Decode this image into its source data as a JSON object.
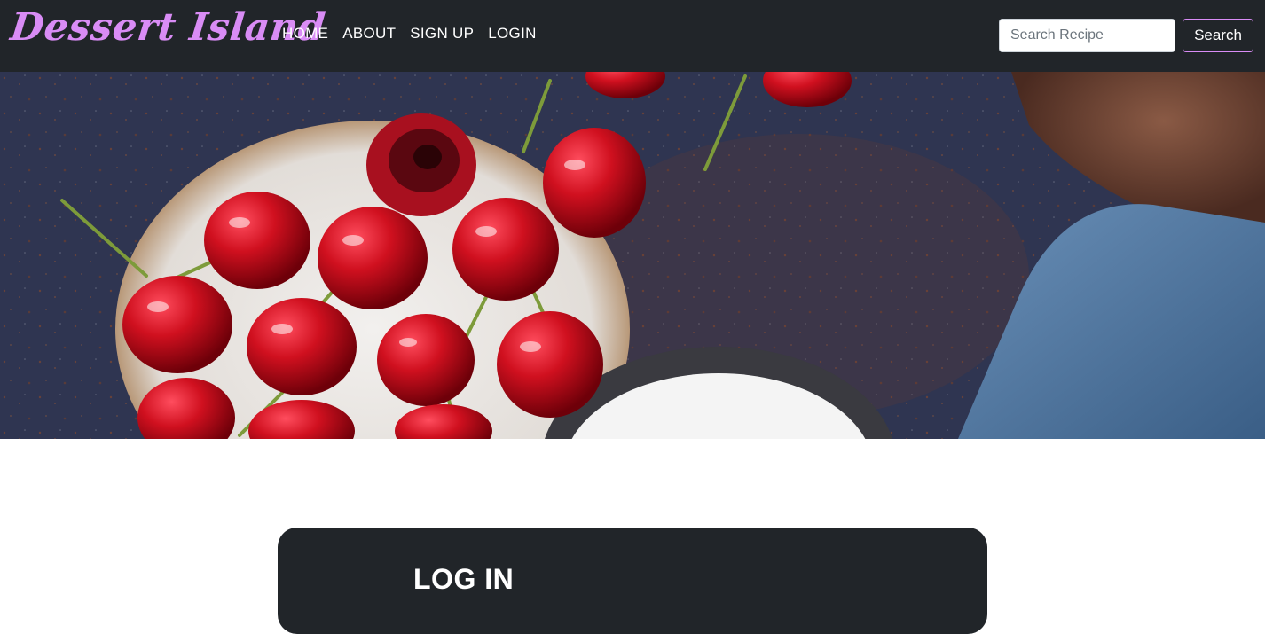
{
  "navbar": {
    "brand": "Dessert Island",
    "links": [
      "HOME",
      "ABOUT",
      "SIGN UP",
      "LOGIN"
    ],
    "search": {
      "placeholder": "Search Recipe",
      "value": "",
      "button_label": "Search"
    }
  },
  "hero": {
    "image": "cherries-on-dark-table"
  },
  "login": {
    "title": "LOG IN"
  },
  "colors": {
    "navbar_bg": "#212529",
    "brand": "#d98cf5",
    "search_border": "#d98cf5",
    "card_bg": "#212529",
    "cherry": "#c8102e",
    "table": "#2f3551"
  }
}
